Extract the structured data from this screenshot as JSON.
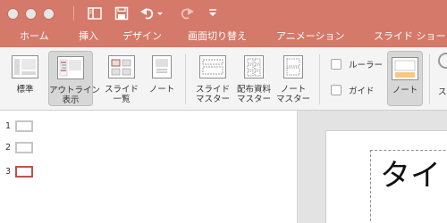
{
  "quick_access": {
    "sidebar_icon": "sidebar-icon",
    "save_icon": "save-icon",
    "undo_icon": "undo-icon",
    "redo_icon": "redo-icon",
    "more_icon": "dropdown-icon"
  },
  "tabs": [
    {
      "label": "ホーム"
    },
    {
      "label": "挿入"
    },
    {
      "label": "デザイン"
    },
    {
      "label": "画面切り替え"
    },
    {
      "label": "アニメーション"
    },
    {
      "label": "スライド ショー"
    }
  ],
  "ribbon": {
    "normal": "標準",
    "outline_1": "アウトライン",
    "outline_2": "表示",
    "sorter_1": "スライド",
    "sorter_2": "一覧",
    "notes_page": "ノート",
    "slide_master_1": "スライド",
    "slide_master_2": "マスター",
    "handout_master_1": "配布資料",
    "handout_master_2": "マスター",
    "notes_master_1": "ノート",
    "notes_master_2": "マスター",
    "ruler": "ルーラー",
    "guides": "ガイド",
    "notes": "ノート",
    "cut_off": "ス"
  },
  "slides": [
    {
      "number": "1"
    },
    {
      "number": "2"
    },
    {
      "number": "3"
    }
  ],
  "editor": {
    "title_text": "タイ"
  },
  "colors": {
    "accent": "#d5796a",
    "selected_thumb": "#c0504d"
  }
}
